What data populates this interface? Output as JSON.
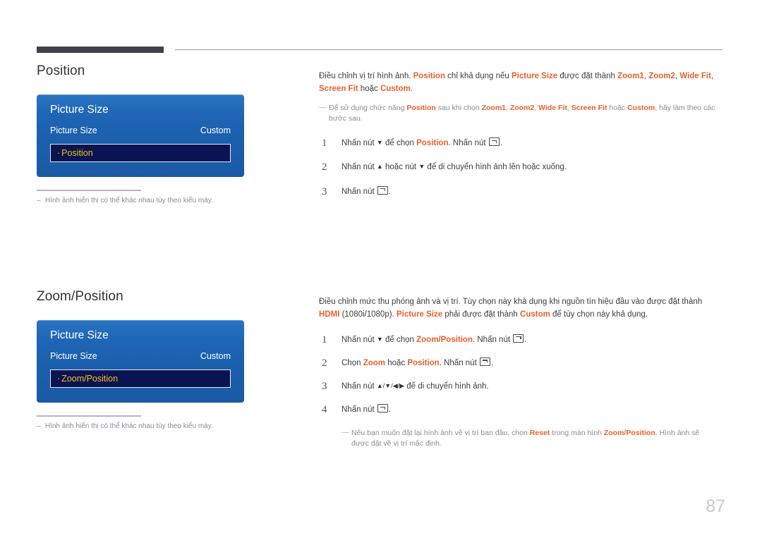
{
  "page": {
    "number": "87"
  },
  "sections": [
    {
      "title": "Position",
      "panel": {
        "title": "Picture Size",
        "row_label": "Picture Size",
        "row_value": "Custom",
        "highlight_bullet": "·",
        "highlight_label": "Position"
      },
      "caption": {
        "dash": "–",
        "text": "Hình ảnh hiển thị có thể khác nhau tùy theo kiểu máy."
      },
      "body": {
        "t1": "Điều chỉnh vị trí hình ảnh. ",
        "kw1": "Position",
        "t2": " chỉ khả dụng nếu ",
        "kw2": "Picture Size",
        "t3": " được đặt thành ",
        "kw3": "Zoom1",
        "t4": ", ",
        "kw4": "Zoom2",
        "t5": ", ",
        "kw5": "Wide Fit",
        "t6": ", ",
        "kw6": "Screen Fit",
        "t7": " hoặc ",
        "kw7": "Custom",
        "t8": "."
      },
      "note": {
        "dash": "―",
        "t1": "Để sử dụng chức năng ",
        "kw1": "Position",
        "t2": " sau khi chọn ",
        "kw2": "Zoom1",
        "t3": ", ",
        "kw3": "Zoom2",
        "t4": ", ",
        "kw4": "Wide Fit",
        "t5": ", ",
        "kw5": "Screen Fit",
        "t6": " hoặc ",
        "kw6": "Custom",
        "t7": ", hãy làm theo các bước sau."
      },
      "steps": [
        {
          "num": "1",
          "t1": "Nhấn nút ",
          "arrow1": "▼",
          "t2": " để chọn ",
          "kw1": "Position",
          "t3": ". Nhấn nút ",
          "t4": "."
        },
        {
          "num": "2",
          "t1": "Nhấn nút ",
          "arrow1": "▲",
          "t2": " hoặc nút ",
          "arrow2": "▼",
          "t3": " để di chuyển hình ảnh lên hoặc xuống."
        },
        {
          "num": "3",
          "t1": "Nhấn nút ",
          "t2": "."
        }
      ]
    },
    {
      "title": "Zoom/Position",
      "panel": {
        "title": "Picture Size",
        "row_label": "Picture Size",
        "row_value": "Custom",
        "highlight_bullet": "·",
        "highlight_label": "Zoom/Position"
      },
      "caption": {
        "dash": "–",
        "text": "Hình ảnh hiển thị có thể khác nhau tùy theo kiểu máy."
      },
      "body": {
        "t1": "Điều chỉnh mức thu phóng ảnh và vị trí. Tùy chọn này khả dụng khi nguồn tín hiệu đầu vào được đặt thành ",
        "kw1": "HDMI",
        "t2": " (1080i/1080p). ",
        "kw2": "Picture Size",
        "t3": " phải được đặt thành ",
        "kw3": "Custom",
        "t4": " để tùy chọn này khả dụng."
      },
      "steps": [
        {
          "num": "1",
          "t1": "Nhấn nút ",
          "arrow1": "▼",
          "t2": " để chọn ",
          "kw1": "Zoom/Position",
          "t3": ". Nhấn nút ",
          "t4": "."
        },
        {
          "num": "2",
          "t1": "Chọn ",
          "kw1": "Zoom",
          "t2": " hoặc ",
          "kw2": "Position",
          "t3": ". Nhấn nút ",
          "t4": "."
        },
        {
          "num": "3",
          "t1": "Nhấn nút ",
          "arrows": "▲/▼/◀/▶",
          "t2": " để di chuyển hình ảnh."
        },
        {
          "num": "4",
          "t1": "Nhấn nút ",
          "t2": "."
        }
      ],
      "footer_note": {
        "dash": "―",
        "t1": "Nếu bạn muốn đặt lại hình ảnh về vị trí ban đầu, chọn ",
        "kw1": "Reset",
        "t2": " trong màn hình ",
        "kw2": "Zoom/Position",
        "t3": ". Hình ảnh sẽ được đặt về vị trí mặc định."
      }
    }
  ]
}
